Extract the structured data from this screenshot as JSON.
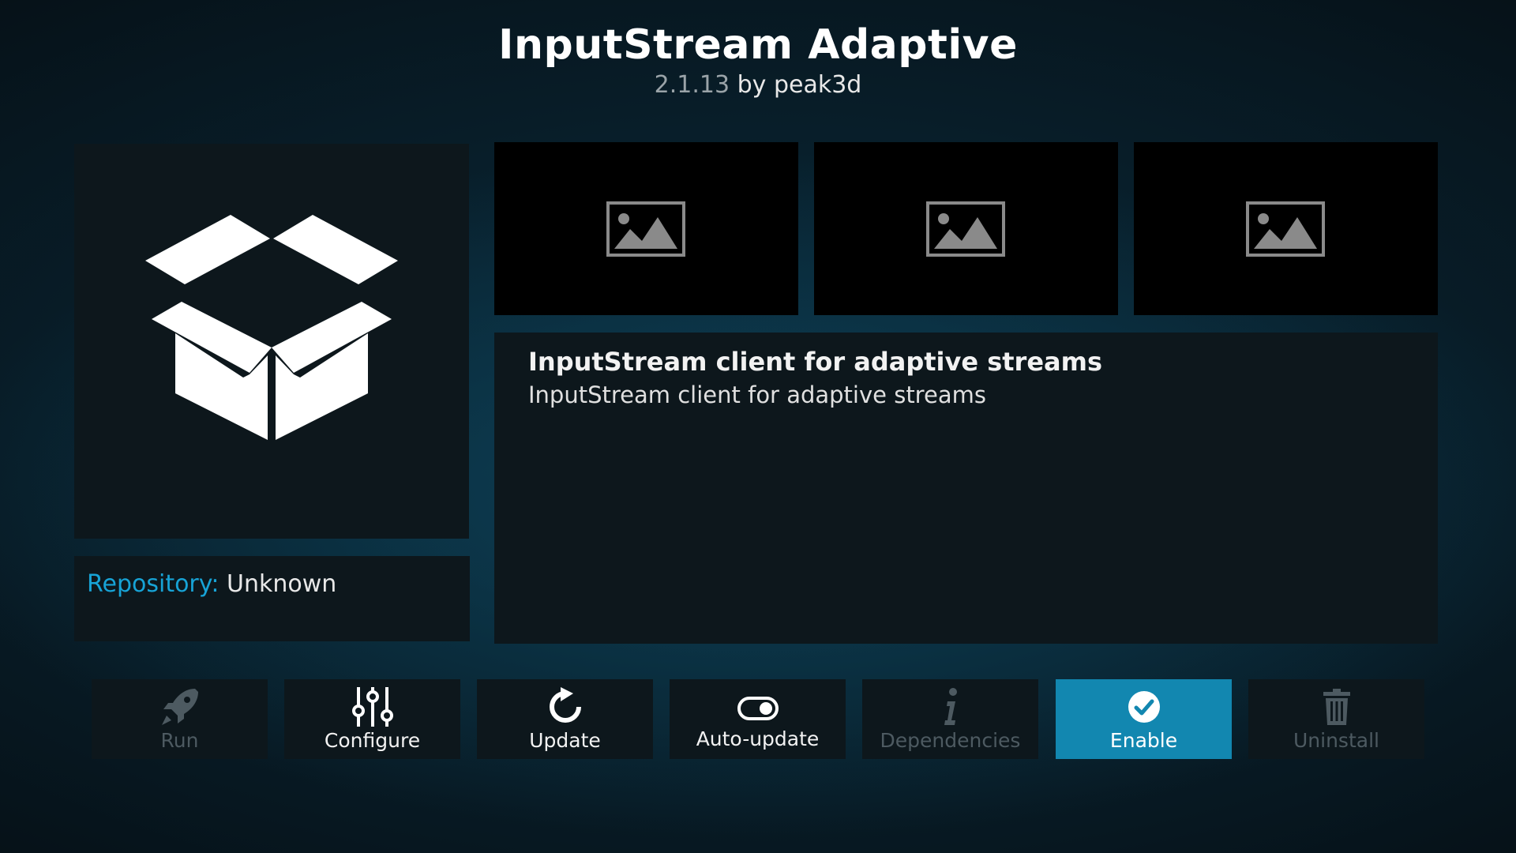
{
  "header": {
    "title": "InputStream Adaptive",
    "version": "2.1.13",
    "by_author": "by peak3d"
  },
  "repository": {
    "label": "Repository:",
    "value": "Unknown"
  },
  "screenshots": [
    {
      "icon": "image-placeholder-icon"
    },
    {
      "icon": "image-placeholder-icon"
    },
    {
      "icon": "image-placeholder-icon"
    }
  ],
  "description": {
    "title": "InputStream client for adaptive streams",
    "body": "InputStream client for adaptive streams"
  },
  "buttons": [
    {
      "label": "Run",
      "icon": "rocket-icon",
      "state": "disabled"
    },
    {
      "label": "Configure",
      "icon": "sliders-icon",
      "state": "enabled"
    },
    {
      "label": "Update",
      "icon": "refresh-icon",
      "state": "enabled"
    },
    {
      "label": "Auto-update",
      "icon": "toggle-icon",
      "state": "enabled"
    },
    {
      "label": "Dependencies",
      "icon": "info-icon",
      "state": "disabled"
    },
    {
      "label": "Enable",
      "icon": "checkmark-circle-icon",
      "state": "focused"
    },
    {
      "label": "Uninstall",
      "icon": "trash-icon",
      "state": "disabled"
    }
  ],
  "colors": {
    "accent": "#1287b0",
    "repository_label": "#17a3d6",
    "panel": "#0d171c",
    "disabled_text": "#4d5a61"
  }
}
